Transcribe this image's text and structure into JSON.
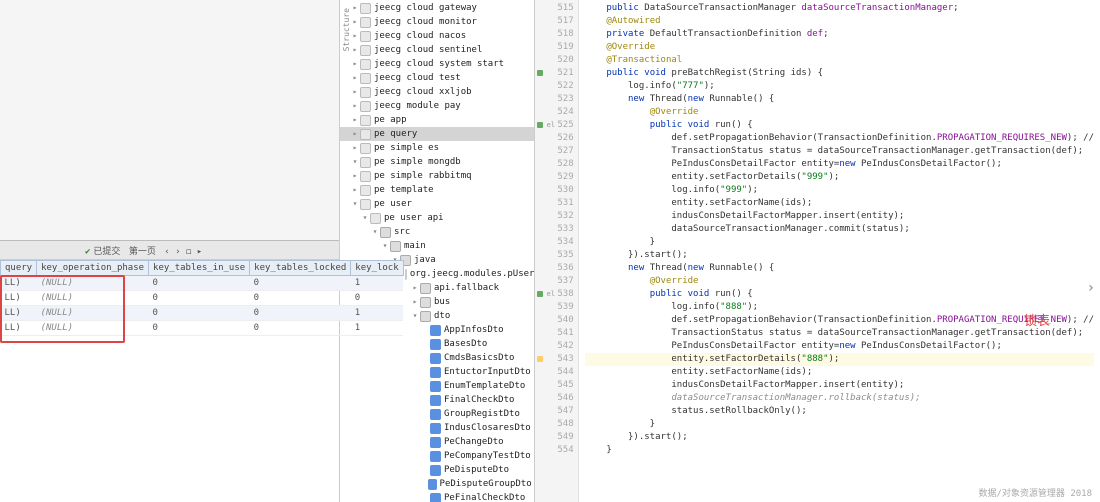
{
  "db": {
    "toolbar": {
      "page_label": "第一页",
      "tx_label": "已提交"
    },
    "headers": [
      "query",
      "key_operation_phase",
      "key_tables_in_use",
      "key_tables_locked",
      "key_lock"
    ],
    "rows": [
      {
        "c0": "LL)",
        "c1": "(NULL)",
        "c2": "0",
        "c3": "0",
        "c4": "1"
      },
      {
        "c0": "LL)",
        "c1": "(NULL)",
        "c2": "0",
        "c3": "0",
        "c4": "0"
      },
      {
        "c0": "LL)",
        "c1": "(NULL)",
        "c2": "0",
        "c3": "0",
        "c4": "1"
      },
      {
        "c0": "LL)",
        "c1": "(NULL)",
        "c2": "0",
        "c3": "0",
        "c4": "1"
      }
    ]
  },
  "tree": [
    {
      "d": 0,
      "ic": "mod",
      "a": "▸",
      "t": "jeecg cloud gateway"
    },
    {
      "d": 0,
      "ic": "mod",
      "a": "▸",
      "t": "jeecg cloud monitor"
    },
    {
      "d": 0,
      "ic": "mod",
      "a": "▸",
      "t": "jeecg cloud nacos"
    },
    {
      "d": 0,
      "ic": "mod",
      "a": "▸",
      "t": "jeecg cloud sentinel"
    },
    {
      "d": 0,
      "ic": "mod",
      "a": "▸",
      "t": "jeecg cloud system start"
    },
    {
      "d": 0,
      "ic": "mod",
      "a": "▸",
      "t": "jeecg cloud test"
    },
    {
      "d": 0,
      "ic": "mod",
      "a": "▸",
      "t": "jeecg cloud xxljob"
    },
    {
      "d": 0,
      "ic": "mod",
      "a": "▸",
      "t": "jeecg module pay"
    },
    {
      "d": 0,
      "ic": "mod",
      "a": "▸",
      "t": "pe app"
    },
    {
      "d": 0,
      "ic": "mod",
      "a": "▸",
      "t": "pe query",
      "sel": true
    },
    {
      "d": 0,
      "ic": "mod",
      "a": "▸",
      "t": "pe simple es"
    },
    {
      "d": 0,
      "ic": "mod",
      "a": "▾",
      "t": "pe simple mongdb"
    },
    {
      "d": 0,
      "ic": "mod",
      "a": "▸",
      "t": "pe simple rabbitmq"
    },
    {
      "d": 0,
      "ic": "mod",
      "a": "▸",
      "t": "pe template"
    },
    {
      "d": 0,
      "ic": "mod",
      "a": "▾",
      "t": "pe user"
    },
    {
      "d": 1,
      "ic": "mod",
      "a": "▾",
      "t": "pe user api"
    },
    {
      "d": 2,
      "ic": "fold",
      "a": "▾",
      "t": "src"
    },
    {
      "d": 3,
      "ic": "fold",
      "a": "▾",
      "t": "main"
    },
    {
      "d": 4,
      "ic": "fold",
      "a": "▾",
      "t": "java"
    },
    {
      "d": 5,
      "ic": "pkg",
      "a": "▾",
      "t": "org.jeecg.modules.pUser"
    },
    {
      "d": 6,
      "ic": "fold",
      "a": "▸",
      "t": "api.fallback"
    },
    {
      "d": 6,
      "ic": "fold",
      "a": "▸",
      "t": "bus"
    },
    {
      "d": 6,
      "ic": "fold",
      "a": "▾",
      "t": "dto"
    },
    {
      "d": 7,
      "ic": "cls",
      "a": "",
      "t": "AppInfosDto"
    },
    {
      "d": 7,
      "ic": "cls",
      "a": "",
      "t": "BasesDto"
    },
    {
      "d": 7,
      "ic": "cls",
      "a": "",
      "t": "CmdsBasicsDto"
    },
    {
      "d": 7,
      "ic": "cls",
      "a": "",
      "t": "EntuctorInputDto"
    },
    {
      "d": 7,
      "ic": "cls",
      "a": "",
      "t": "EnumTemplateDto"
    },
    {
      "d": 7,
      "ic": "cls",
      "a": "",
      "t": "FinalCheckDto"
    },
    {
      "d": 7,
      "ic": "cls",
      "a": "",
      "t": "GroupRegistDto"
    },
    {
      "d": 7,
      "ic": "cls",
      "a": "",
      "t": "IndusClosaresDto"
    },
    {
      "d": 7,
      "ic": "cls",
      "a": "",
      "t": "PeChangeDto"
    },
    {
      "d": 7,
      "ic": "cls",
      "a": "",
      "t": "PeCompanyTestDto"
    },
    {
      "d": 7,
      "ic": "cls",
      "a": "",
      "t": "PeDisputeDto"
    },
    {
      "d": 7,
      "ic": "cls",
      "a": "",
      "t": "PeDisputeGroupDto"
    },
    {
      "d": 7,
      "ic": "cls",
      "a": "",
      "t": "PeFinalCheckDto"
    }
  ],
  "code": {
    "lines": [
      {
        "n": "515",
        "h": "    <span class='kw'>public</span> DataSourceTransactionManager <span class='fld'>dataSourceTransactionManager</span>;"
      },
      {
        "n": "517",
        "h": "    <span class='ann'>@Autowired</span>"
      },
      {
        "n": "518",
        "h": "    <span class='kw'>private</span> DefaultTransactionDefinition <span class='fld'>def</span>;"
      },
      {
        "n": "519",
        "h": "    <span class='ann'>@Override</span>"
      },
      {
        "n": "520",
        "h": "    <span class='ann'>@Transactional</span>"
      },
      {
        "n": "521",
        "m": "g",
        "h": "    <span class='kw'>public void</span> preBatchRegist(String ids) {"
      },
      {
        "n": "522",
        "h": "        log.info(<span class='str'>\"777\"</span>);"
      },
      {
        "n": "523",
        "h": "        <span class='kw'>new</span> Thread(<span class='kw'>new</span> Runnable() {"
      },
      {
        "n": "524",
        "h": "            <span class='ann'>@Override</span>"
      },
      {
        "n": "525",
        "m": "g",
        "lbl": "el",
        "h": "            <span class='kw'>public void</span> run() {"
      },
      {
        "n": "526",
        "h": "                def.setPropagationBehavior(TransactionDefinition.<span class='fld'>PROPAGATION_REQUIRES_NEW</span>); //"
      },
      {
        "n": "527",
        "h": "                TransactionStatus status = dataSourceTransactionManager.getTransaction(def);"
      },
      {
        "n": "528",
        "h": "                PeIndusConsDetailFactor entity=<span class='kw'>new</span> PeIndusConsDetailFactor();"
      },
      {
        "n": "529",
        "h": "                entity.setFactorDetails(<span class='str'>\"999\"</span>);"
      },
      {
        "n": "530",
        "h": "                log.info(<span class='str'>\"999\"</span>);"
      },
      {
        "n": "531",
        "h": "                entity.setFactorName(ids);"
      },
      {
        "n": "532",
        "h": "                indusConsDetailFactorMapper.insert(entity);"
      },
      {
        "n": "533",
        "h": "                dataSourceTransactionManager.commit(status);"
      },
      {
        "n": "534",
        "h": "            }"
      },
      {
        "n": "535",
        "h": "        }).start();"
      },
      {
        "n": "536",
        "h": "        <span class='kw'>new</span> Thread(<span class='kw'>new</span> Runnable() {"
      },
      {
        "n": "537",
        "h": "            <span class='ann'>@Override</span>"
      },
      {
        "n": "538",
        "m": "g",
        "lbl": "el",
        "h": "            <span class='kw'>public void</span> run() {"
      },
      {
        "n": "539",
        "h": "                log.info(<span class='str'>\"888\"</span>);"
      },
      {
        "n": "540",
        "h": "                def.setPropagationBehavior(TransactionDefinition.<span class='fld'>PROPAGATION_REQUIRES_NEW</span>); //"
      },
      {
        "n": "541",
        "h": "                TransactionStatus status = dataSourceTransactionManager.getTransaction(def);"
      },
      {
        "n": "542",
        "h": "                PeIndusConsDetailFactor entity=<span class='kw'>new</span> PeIndusConsDetailFactor();"
      },
      {
        "n": "543",
        "m": "w",
        "cur": true,
        "h": "                entity.setFactorDetails(<span class='str'>\"888\"</span>);"
      },
      {
        "n": "544",
        "h": "                entity.setFactorName(ids);"
      },
      {
        "n": "545",
        "h": "                indusConsDetailFactorMapper.insert(entity);"
      },
      {
        "n": "546",
        "h": "                <span class='cmt'>dataSourceTransactionManager.rollback(status);</span>"
      },
      {
        "n": "547",
        "h": "                status.setRollbackOnly();"
      },
      {
        "n": "548",
        "h": "            }"
      },
      {
        "n": "549",
        "h": "        }).start();"
      },
      {
        "n": "554",
        "h": "    }"
      }
    ]
  },
  "red_label": "锁表",
  "struct_tab": "Structure",
  "watermark": "数据/对象资源管理器 2018"
}
